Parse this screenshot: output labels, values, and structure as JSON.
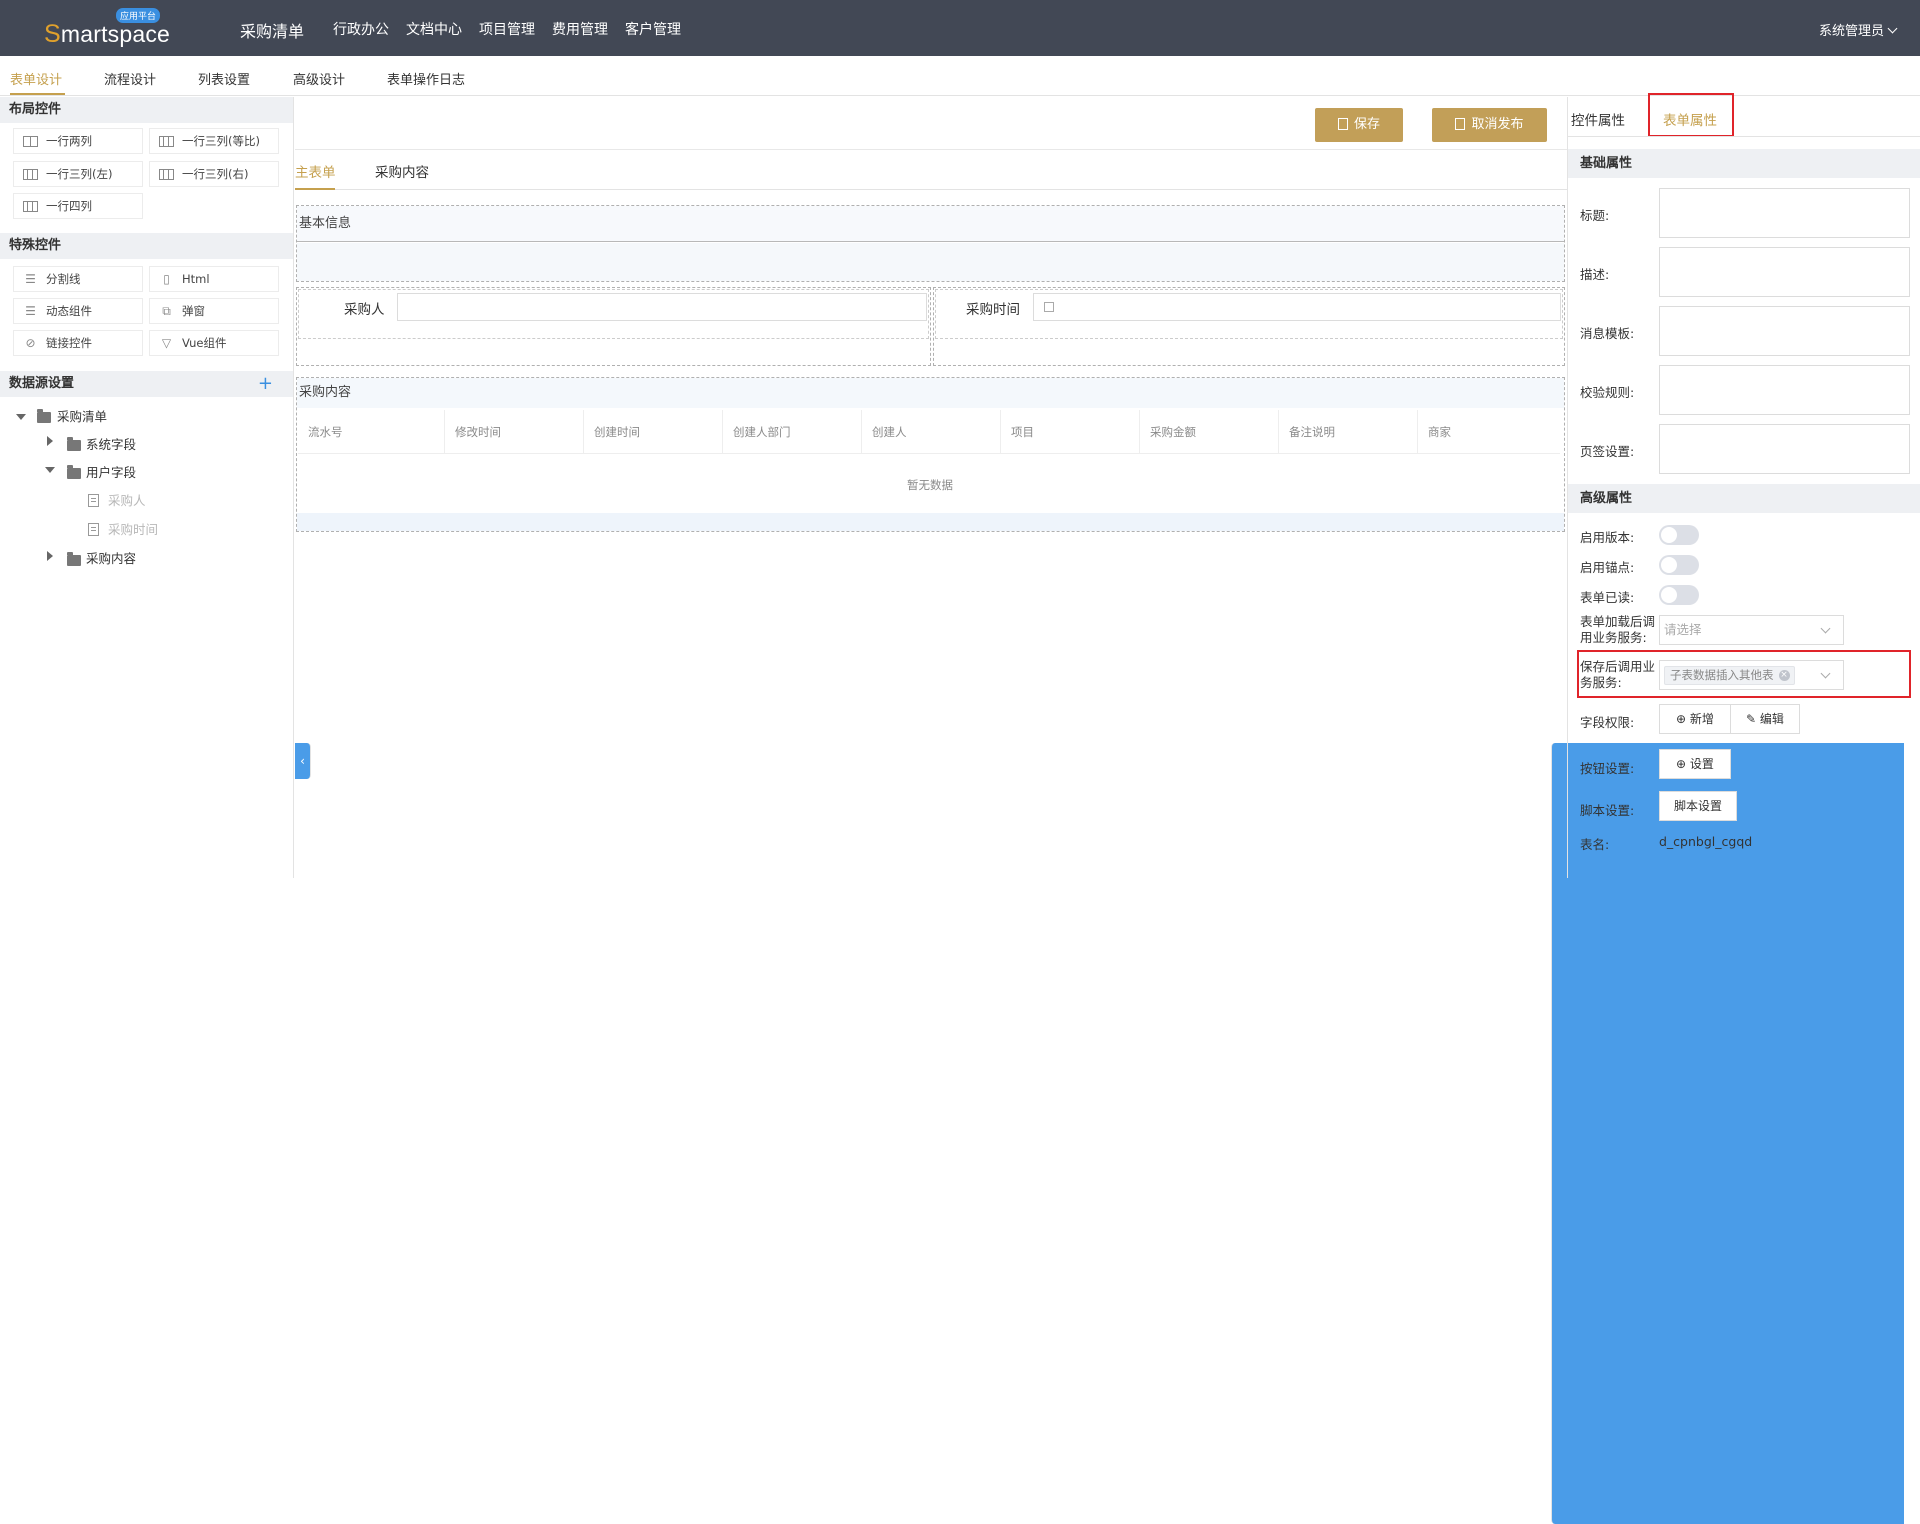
{
  "header": {
    "logo_text_prefix": "S",
    "logo_text_rest": "martspace",
    "logo_badge": "应用平台",
    "app_title": "采购清单",
    "nav": [
      "行政办公",
      "文档中心",
      "项目管理",
      "费用管理",
      "客户管理"
    ],
    "user": "系统管理员"
  },
  "subtabs": [
    "表单设计",
    "流程设计",
    "列表设置",
    "高级设计",
    "表单操作日志"
  ],
  "left": {
    "layout_title": "布局控件",
    "layout_items": [
      "一行两列",
      "一行三列(等比)",
      "一行三列(左)",
      "一行三列(右)",
      "一行四列"
    ],
    "special_title": "特殊控件",
    "special_items": [
      {
        "label": "分割线",
        "icon": "divider-icon"
      },
      {
        "label": "Html",
        "icon": "html-icon"
      },
      {
        "label": "动态组件",
        "icon": "dynamic-icon"
      },
      {
        "label": "弹窗",
        "icon": "popup-icon"
      },
      {
        "label": "链接控件",
        "icon": "link-icon"
      },
      {
        "label": "Vue组件",
        "icon": "vue-icon"
      }
    ],
    "datasource_title": "数据源设置",
    "tree": {
      "root": "采购清单",
      "system": "系统字段",
      "user": "用户字段",
      "user_children": [
        "采购人",
        "采购时间"
      ],
      "content": "采购内容"
    }
  },
  "center": {
    "save_label": "保存",
    "unpublish_label": "取消发布",
    "tabs": [
      "主表单",
      "采购内容"
    ],
    "group_basic": "基本信息",
    "buyer_label": "采购人",
    "buyer_value": "",
    "time_label": "采购时间",
    "time_value": "",
    "group_content": "采购内容",
    "table_columns": [
      "流水号",
      "修改时间",
      "创建时间",
      "创建人部门",
      "创建人",
      "项目",
      "采购金额",
      "备注说明",
      "商家"
    ],
    "empty_text": "暂无数据"
  },
  "right": {
    "tabs": [
      "控件属性",
      "表单属性"
    ],
    "basic_title": "基础属性",
    "basic_fields": [
      "标题:",
      "描述:",
      "消息模板:",
      "校验规则:",
      "页签设置:"
    ],
    "advanced_title": "高级属性",
    "toggles": [
      {
        "label": "启用版本:",
        "on": false
      },
      {
        "label": "启用锚点:",
        "on": false
      },
      {
        "label": "表单已读:",
        "on": false
      }
    ],
    "load_service_label_1": "表单加载后调",
    "load_service_label_2": "用业务服务:",
    "load_service_placeholder": "请选择",
    "save_service_label_1": "保存后调用业",
    "save_service_label_2": "务服务:",
    "save_service_tag": "子表数据插入其他表",
    "field_perm_label": "字段权限:",
    "add_label": "新增",
    "edit_label": "编辑",
    "button_setting_label": "按钮设置:",
    "setting_label": "设置",
    "script_label": "脚本设置:",
    "script_btn": "脚本设置",
    "table_name_label": "表名:",
    "table_name": "d_cpnbgl_cgqd"
  },
  "colors": {
    "header_bg": "#424855",
    "accent_gold": "#c29f58",
    "highlight_red": "#e0242a",
    "toggle_blue": "#4a9ce8"
  }
}
